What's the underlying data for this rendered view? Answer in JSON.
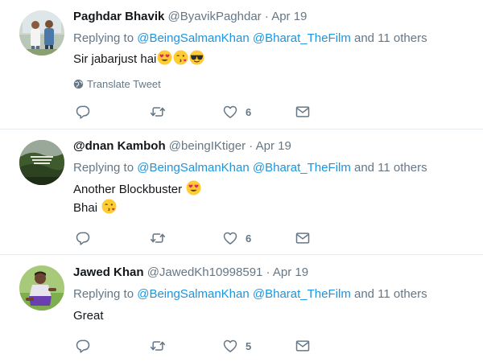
{
  "tweets": [
    {
      "name": "Paghdar Bhavik",
      "handle": "@ByavikPaghdar",
      "separator": "·",
      "time": "Apr 19",
      "replying_prefix": "Replying to",
      "mention1": "@BeingSalmanKhan",
      "mention2": "@Bharat_TheFilm",
      "and_others": "and 11 others",
      "lines": [
        "Sir jabarjust hai"
      ],
      "emojis": [
        "heart-eyes-emoji",
        "kiss-emoji",
        "sunglasses-emoji"
      ],
      "translate": "Translate Tweet",
      "likes": "6"
    },
    {
      "name": "@dnan Kamboh",
      "handle": "@beingIKtiger",
      "separator": "·",
      "time": "Apr 19",
      "replying_prefix": "Replying to",
      "mention1": "@BeingSalmanKhan",
      "mention2": "@Bharat_TheFilm",
      "and_others": "and 11 others",
      "lines": [
        "Another Blockbuster",
        "Bhai"
      ],
      "emojis": [
        "heart-eyes-emoji",
        "kiss-emoji"
      ],
      "likes": "6"
    },
    {
      "name": "Jawed Khan",
      "handle": "@JawedKh10998591",
      "separator": "·",
      "time": "Apr 19",
      "replying_prefix": "Replying to",
      "mention1": "@BeingSalmanKhan",
      "mention2": "@Bharat_TheFilm",
      "and_others": "and 11 others",
      "lines": [
        "Great"
      ],
      "likes": "5"
    }
  ],
  "colors": {
    "link": "#1b95e0",
    "secondary": "#657786",
    "text": "#14171a",
    "divider": "#e6ecf0"
  },
  "icons": [
    "reply-icon",
    "retweet-icon",
    "like-icon",
    "message-icon",
    "globe-icon"
  ]
}
